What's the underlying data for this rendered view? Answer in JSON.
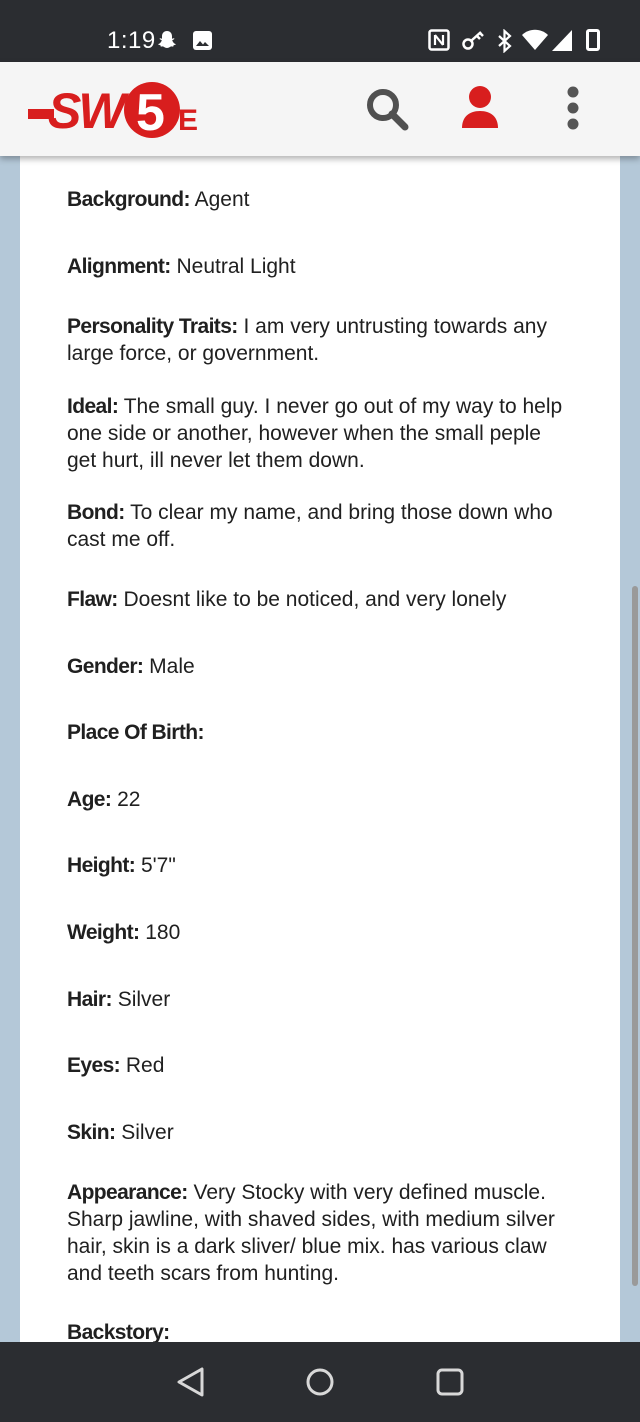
{
  "status_bar": {
    "time": "1:19",
    "icons": [
      "snapchat-icon",
      "photo-icon",
      "nfc-icon",
      "vpn-key-icon",
      "bluetooth-icon",
      "wifi-icon",
      "cellular-signal-icon",
      "battery-icon"
    ]
  },
  "header": {
    "logo_text": "SW5E",
    "brand_color": "#d81e1e",
    "icons": {
      "search": "search-icon",
      "account": "user-icon",
      "menu": "more-vert-icon"
    }
  },
  "fields": [
    {
      "label": "Background:",
      "value": "Agent"
    },
    {
      "label": "Alignment:",
      "value": "Neutral Light"
    },
    {
      "label": "Personality Traits:",
      "value": "I am very untrusting towards any large force, or government."
    },
    {
      "label": "Ideal:",
      "value": "The small guy. I never go out of my way to help one side or another, however when the small peple get hurt, ill never let them down."
    },
    {
      "label": "Bond:",
      "value": "To clear my name, and bring those down who cast me off."
    },
    {
      "label": "Flaw:",
      "value": "Doesnt like to be noticed, and very lonely"
    },
    {
      "label": "Gender:",
      "value": "Male"
    },
    {
      "label": "Place Of Birth:",
      "value": ""
    },
    {
      "label": "Age:",
      "value": "22"
    },
    {
      "label": "Height:",
      "value": "5'7\""
    },
    {
      "label": "Weight:",
      "value": "180"
    },
    {
      "label": "Hair:",
      "value": "Silver"
    },
    {
      "label": "Eyes:",
      "value": "Red"
    },
    {
      "label": "Skin:",
      "value": "Silver"
    },
    {
      "label": "Appearance:",
      "value": "Very Stocky with very defined muscle. Sharp jawline, with shaved sides, with medium silver hair, skin is a dark sliver/ blue mix. has various claw and teeth scars from hunting."
    },
    {
      "label": "Backstory:",
      "value": ""
    }
  ],
  "nav_bar": {
    "icons": [
      "back-icon",
      "home-icon",
      "recents-icon"
    ]
  }
}
